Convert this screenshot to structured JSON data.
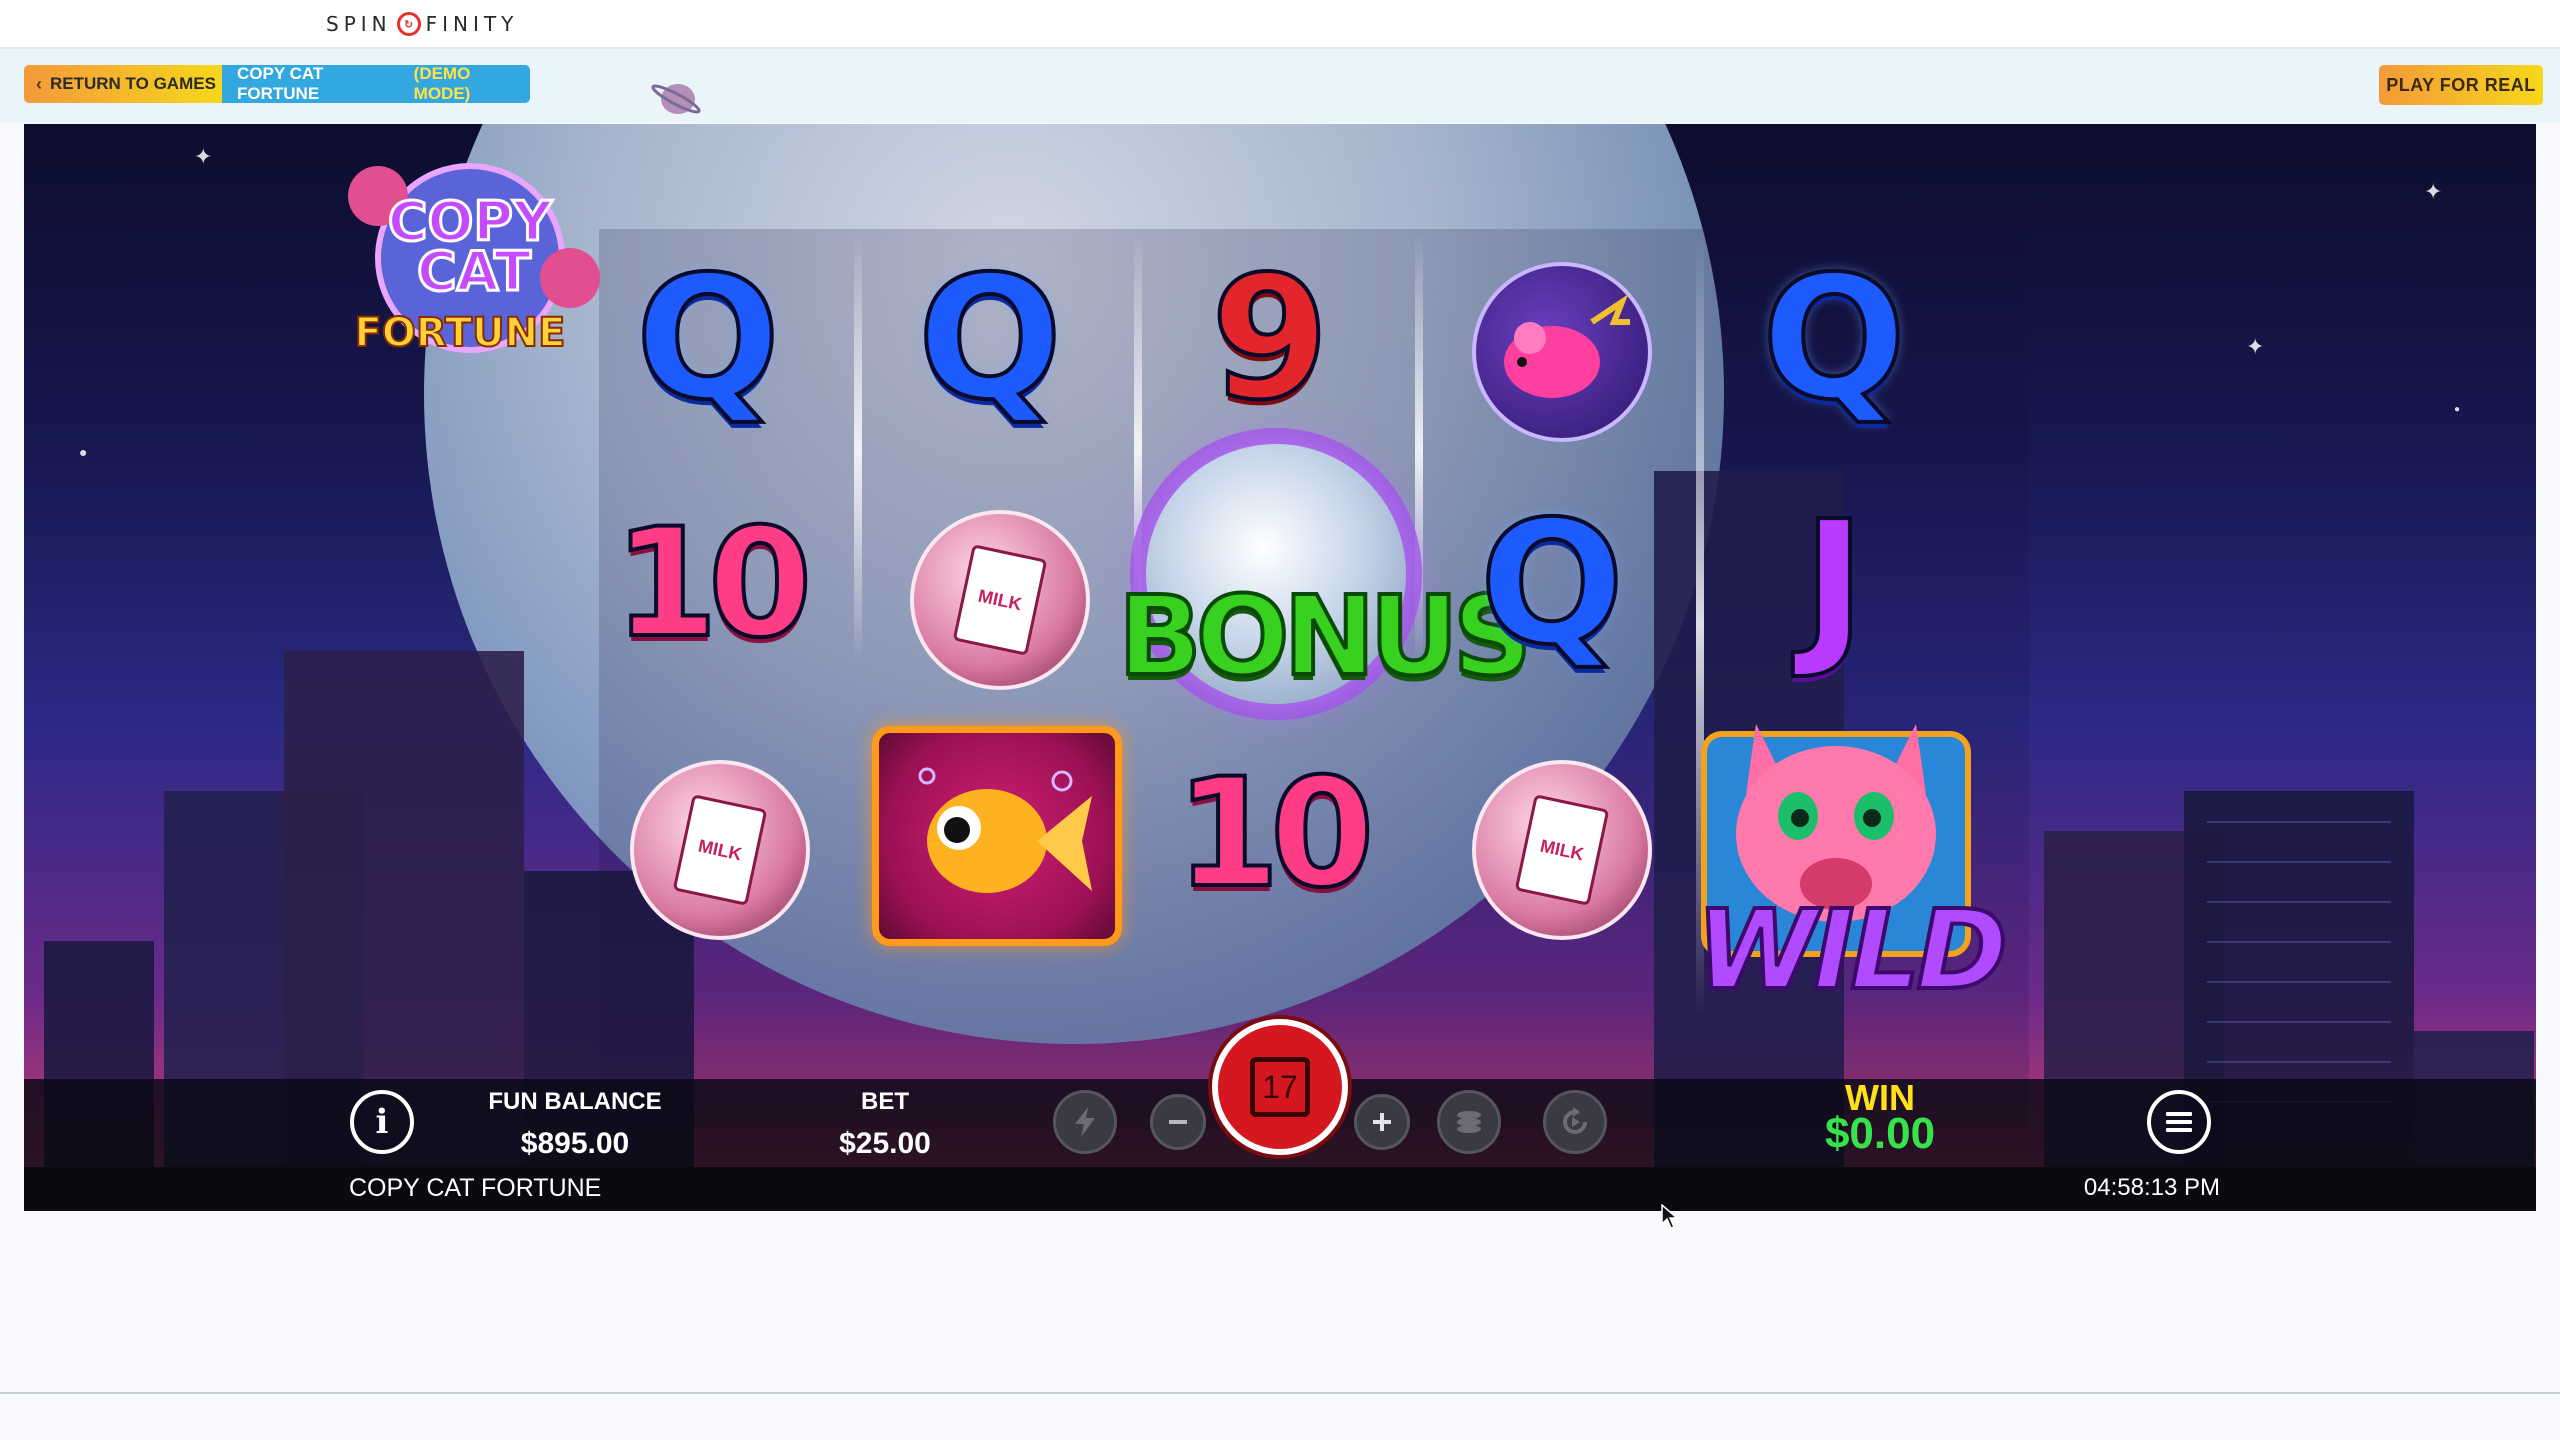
{
  "brand": {
    "name_left": "SPIN",
    "name_right": "FINITY"
  },
  "subbar": {
    "return_label": "RETURN TO GAMES",
    "game_title": "COPY CAT FORTUNE",
    "mode_label": "(DEMO MODE)",
    "play_real_label": "PLAY FOR REAL"
  },
  "game": {
    "logo_lines": [
      "COPY",
      "CAT",
      "FORTUNE"
    ],
    "reels": [
      [
        "Q",
        "10",
        "milk"
      ],
      [
        "Q",
        "milk",
        "fish"
      ],
      [
        "9",
        "bonus",
        "10"
      ],
      [
        "mouse",
        "Q",
        "milk"
      ],
      [
        "Q",
        "J",
        "wild"
      ]
    ],
    "symbol_text": {
      "milk": "MILK",
      "bonus": "BONUS",
      "wild": "WILD"
    }
  },
  "controls": {
    "fun_balance_label": "FUN BALANCE",
    "fun_balance_value": "$895.00",
    "bet_label": "BET",
    "bet_value": "$25.00",
    "spin_count": "17",
    "win_label": "WIN",
    "win_value": "$0.00",
    "game_name": "COPY CAT FORTUNE",
    "clock": "04:58:13 PM"
  },
  "icons": {
    "info": "info-icon",
    "turbo": "lightning-icon",
    "minus": "minus-icon",
    "plus": "plus-icon",
    "coins": "coins-icon",
    "autoplay": "autoplay-icon",
    "menu": "hamburger-menu-icon"
  },
  "colors": {
    "accent_orange": "#f39a3a",
    "accent_blue": "#33a8e0",
    "spin_red": "#d5181f",
    "win_yellow": "#ffe11a",
    "win_green": "#35e34a"
  }
}
